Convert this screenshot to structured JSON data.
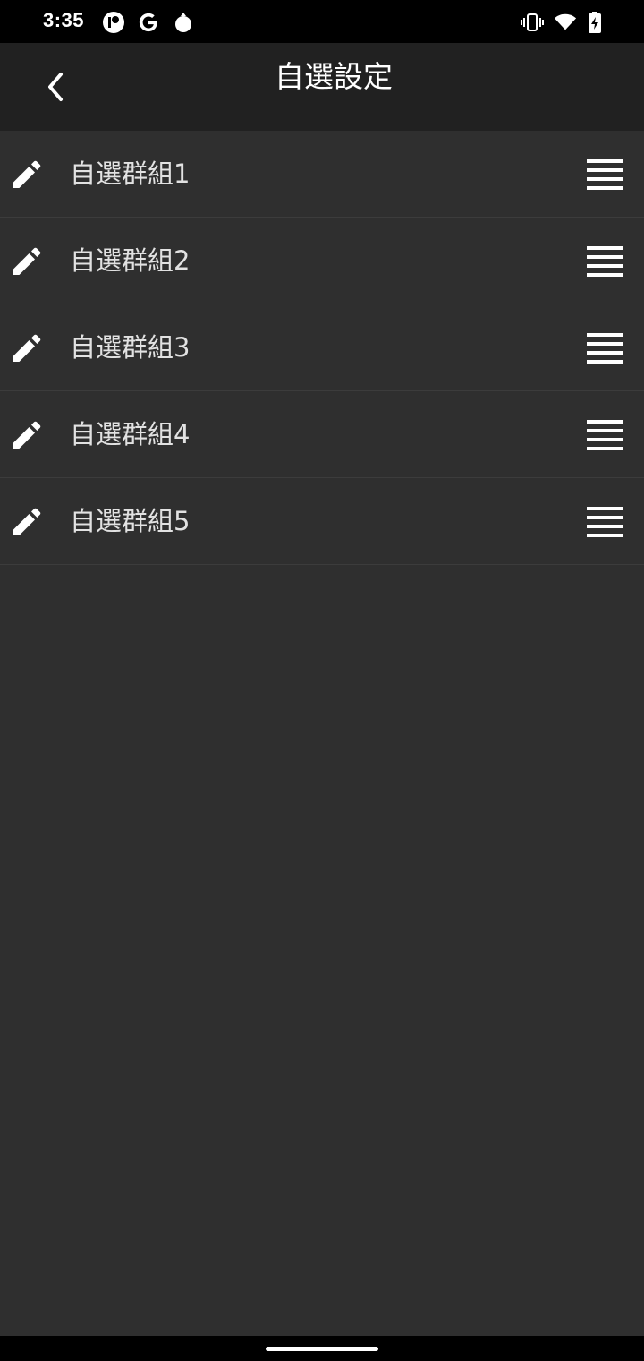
{
  "status_bar": {
    "time": "3:35",
    "icons": [
      "notification-app-icon",
      "google-icon",
      "pomegranate-app-icon",
      "vibrate-icon",
      "wifi-icon",
      "battery-charging-icon"
    ]
  },
  "header": {
    "title": "自選設定",
    "back_icon": "chevron-left-icon"
  },
  "groups": [
    {
      "name": "自選群組1",
      "edit_icon": "pencil-icon",
      "handle_icon": "drag-handle-icon"
    },
    {
      "name": "自選群組2",
      "edit_icon": "pencil-icon",
      "handle_icon": "drag-handle-icon"
    },
    {
      "name": "自選群組3",
      "edit_icon": "pencil-icon",
      "handle_icon": "drag-handle-icon"
    },
    {
      "name": "自選群組4",
      "edit_icon": "pencil-icon",
      "handle_icon": "drag-handle-icon"
    },
    {
      "name": "自選群組5",
      "edit_icon": "pencil-icon",
      "handle_icon": "drag-handle-icon"
    }
  ],
  "colors": {
    "background": "#2f2f2f",
    "toolbar": "#212121",
    "text_primary": "#ffffff",
    "text_list": "#e2e2e2",
    "divider": "#3c3c3c"
  }
}
